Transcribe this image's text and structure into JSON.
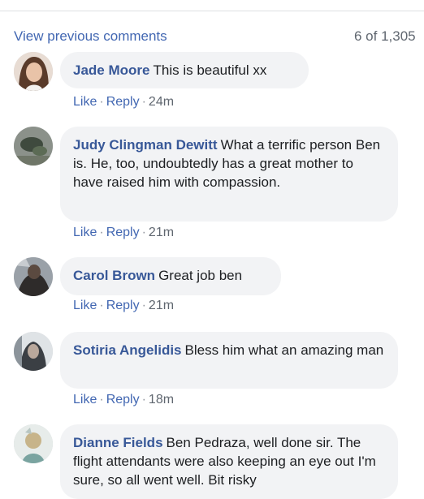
{
  "header": {
    "view_previous": "View previous comments",
    "count": "6 of 1,305"
  },
  "actions": {
    "like": "Like",
    "reply": "Reply",
    "separator": "·"
  },
  "comments": [
    {
      "author": "Jade Moore",
      "text": "This is beautiful xx",
      "time": "24m"
    },
    {
      "author": "Judy Clingman Dewitt",
      "text": "What a terrific person Ben is. He, too, undoubtedly has a great mother to have raised him with compassion.",
      "time": "21m"
    },
    {
      "author": "Carol Brown",
      "text": "Great job ben",
      "time": "21m"
    },
    {
      "author": "Sotiria Angelidis",
      "text": "Bless him what an amazing man",
      "time": "18m"
    },
    {
      "author": "Dianne Fields",
      "text": "Ben Pedraza, well done sir. The flight attendants were also keeping an eye out I'm sure, so all went well. Bit risky"
    }
  ]
}
